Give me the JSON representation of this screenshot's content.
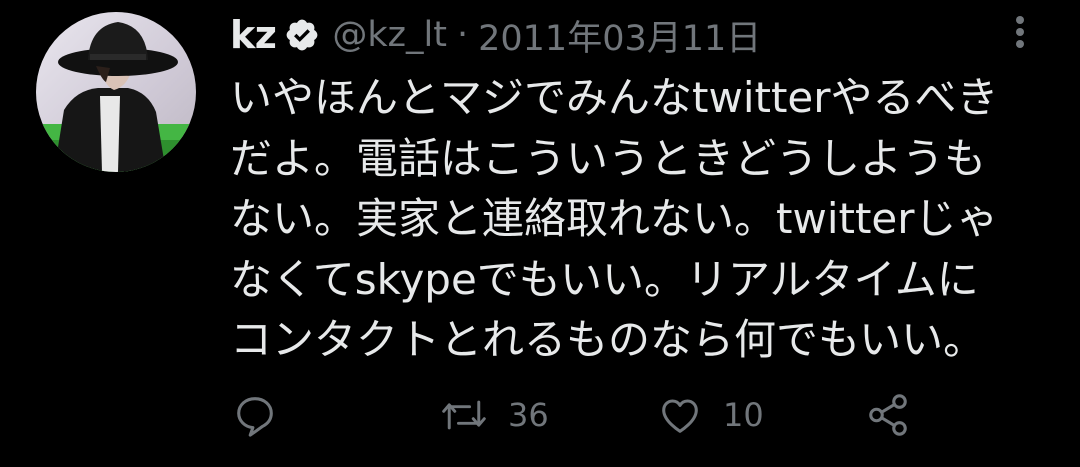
{
  "tweet": {
    "author": {
      "display_name": "kz",
      "handle": "@kz_lt",
      "verified": true
    },
    "separator": "·",
    "timestamp": "2011年03月11日",
    "text_lines": [
      "いやほんとマジでみんなtwitterやるべき",
      "だよ。電話はこういうときどうしようも",
      "ない。実家と連絡取れない。twitterじゃ",
      "なくてskypeでもいい。リアルタイムに",
      "コンタクトとれるものなら何でもいい。"
    ],
    "stats": {
      "retweets": "36",
      "likes": "10"
    }
  },
  "colors": {
    "background": "#000000",
    "primary_text": "#e7e9ea",
    "secondary_text": "#71767b"
  },
  "icons": {
    "reply": "reply-icon",
    "retweet": "retweet-icon",
    "like": "like-icon",
    "share": "share-icon",
    "more": "more-icon",
    "verified": "verified-badge-icon"
  }
}
